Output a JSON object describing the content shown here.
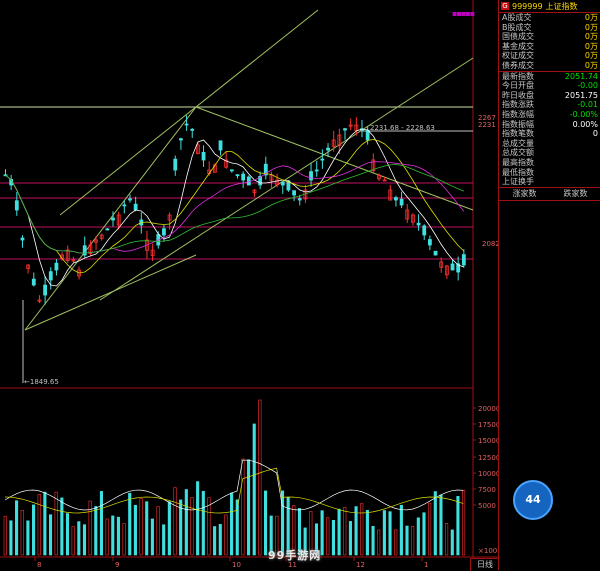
{
  "panel": {
    "code": "999999",
    "name": "上证指数",
    "badge": "G",
    "volume_rows": [
      {
        "label": "A股成交",
        "value": "0万"
      },
      {
        "label": "B股成交",
        "value": "0万"
      },
      {
        "label": "国债成交",
        "value": "0万"
      },
      {
        "label": "基金成交",
        "value": "0万"
      },
      {
        "label": "权证成交",
        "value": "0万"
      },
      {
        "label": "债券成交",
        "value": "0万"
      }
    ],
    "index_rows": [
      {
        "label": "最新指数",
        "value": "2051.74",
        "color": "green"
      },
      {
        "label": "今日开盘",
        "value": "-0.00",
        "color": "green"
      },
      {
        "label": "昨日收盘",
        "value": "2051.75",
        "color": "white"
      },
      {
        "label": "指数涨跌",
        "value": "-0.01",
        "color": "green"
      },
      {
        "label": "指数涨幅",
        "value": "-0.00%",
        "color": "green"
      },
      {
        "label": "指数振幅",
        "value": "0.00%",
        "color": "white"
      },
      {
        "label": "指数笔数",
        "value": "0",
        "color": "white"
      },
      {
        "label": "总成交量",
        "value": "",
        "color": "white"
      },
      {
        "label": "总成交额",
        "value": "",
        "color": "white"
      },
      {
        "label": "最高指数",
        "value": "",
        "color": "white"
      },
      {
        "label": "最低指数",
        "value": "",
        "color": "white"
      },
      {
        "label": "上证换手",
        "value": "",
        "color": "white"
      }
    ],
    "tabs": [
      "涨家数",
      "跌家数"
    ]
  },
  "chart": {
    "annotations": {
      "low_label": "←1849.65",
      "high_label": "2231.68 - 2228.63",
      "right_tick_top": "2267",
      "right_tick_mid": "2082",
      "right_tick_top2": "2231"
    },
    "volume_ticks": [
      "20000",
      "17500",
      "15000",
      "12500",
      "10000",
      "7500",
      "5000"
    ],
    "volume_unit": "×100",
    "x_ticks": [
      "8",
      "9",
      "10",
      "11",
      "12",
      "1"
    ]
  },
  "bottom_tab": "日线",
  "watermark": "99手游网",
  "logo_value": "44"
}
